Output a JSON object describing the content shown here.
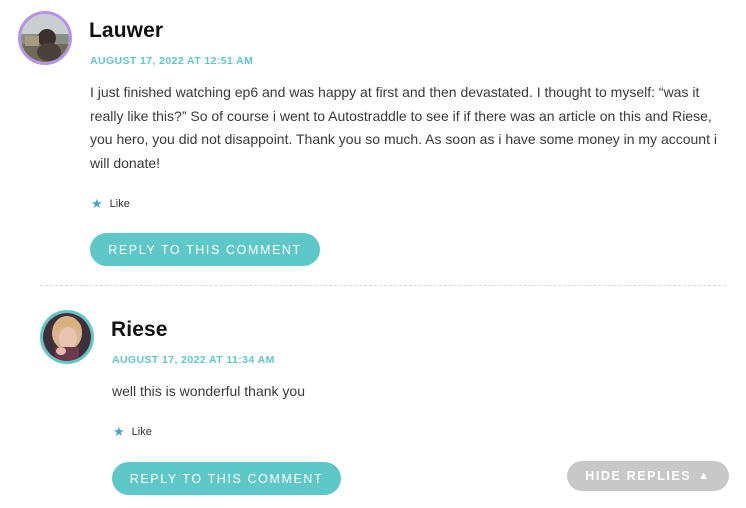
{
  "comments": [
    {
      "author": "Lauwer",
      "date": "AUGUST 17, 2022 AT 12:51 AM",
      "text": "I just finished watching ep6 and was happy at first and then devastated. I thought to myself: “was it really like this?” So of course i went to Autostraddle to see if if there was an article on this and Riese, you hero, you did not disappoint. Thank you so much. As soon as i have some money in my account i will donate!",
      "like_label": "Like",
      "reply_label": "REPLY TO THIS COMMENT"
    },
    {
      "author": "Riese",
      "date": "AUGUST 17, 2022 AT 11:34 AM",
      "text": "well this is wonderful thank you",
      "like_label": "Like",
      "reply_label": "REPLY TO THIS COMMENT"
    }
  ],
  "hide_replies_label": "HIDE REPLIES",
  "icons": {
    "like": "star-icon",
    "hide": "triangle-up-icon"
  },
  "colors": {
    "accent": "#5ec8c8",
    "avatar_ring_1": "#b693e6",
    "avatar_ring_2": "#5ec8c8",
    "hide_button": "#c8c8c8",
    "like_star": "#4aa3c8"
  }
}
